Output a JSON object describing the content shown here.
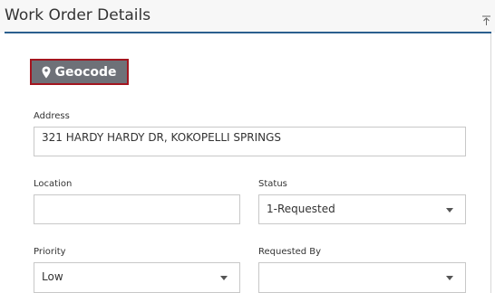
{
  "panel": {
    "title": "Work Order Details",
    "collapse_icon": "collapse-up-icon",
    "accent_color": "#2b5f8e"
  },
  "geocode_button": {
    "label": "Geocode",
    "icon": "map-pin-icon",
    "background": "#6e7178",
    "border_color": "#a3151f"
  },
  "form": {
    "address": {
      "label": "Address",
      "value": "321 HARDY HARDY DR, KOKOPELLI SPRINGS"
    },
    "location": {
      "label": "Location",
      "value": ""
    },
    "status": {
      "label": "Status",
      "value": "1-Requested"
    },
    "priority": {
      "label": "Priority",
      "value": "Low"
    },
    "requested_by": {
      "label": "Requested By",
      "value": ""
    }
  }
}
